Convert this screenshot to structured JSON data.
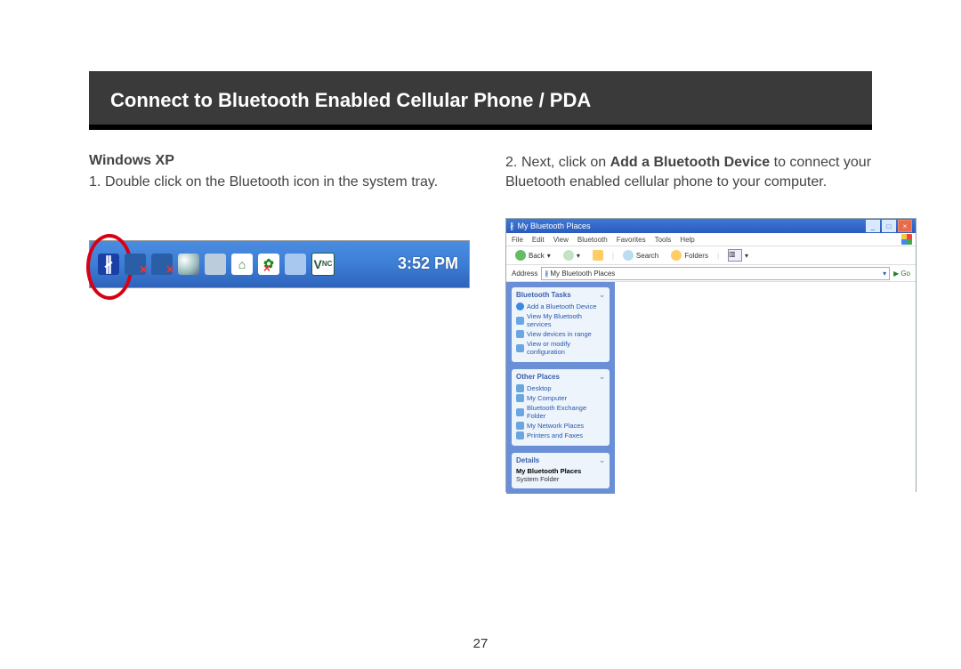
{
  "header": {
    "title": "Connect to Bluetooth Enabled Cellular Phone / PDA"
  },
  "os_label": "Windows XP",
  "steps": {
    "one": {
      "num": "1.",
      "text": "Double click on the Bluetooth icon in the system tray."
    },
    "two": {
      "num": "2.",
      "pre": "Next, click on ",
      "bold": "Add a Bluetooth Device",
      "post": " to connect your Bluetooth enabled cellular phone to your computer."
    }
  },
  "tray": {
    "clock": "3:52 PM"
  },
  "explorer": {
    "title": "My Bluetooth Places",
    "menus": [
      "File",
      "Edit",
      "View",
      "Bluetooth",
      "Favorites",
      "Tools",
      "Help"
    ],
    "toolbar": {
      "back": "Back",
      "search": "Search",
      "folders": "Folders"
    },
    "address": {
      "label": "Address",
      "value": "My Bluetooth Places",
      "go": "Go"
    },
    "panels": {
      "tasks": {
        "header": "Bluetooth Tasks",
        "items": [
          "Add a Bluetooth Device",
          "View My Bluetooth services",
          "View devices in range",
          "View or modify configuration"
        ]
      },
      "other": {
        "header": "Other Places",
        "items": [
          "Desktop",
          "My Computer",
          "Bluetooth Exchange Folder",
          "My Network Places",
          "Printers and Faxes"
        ]
      },
      "details": {
        "header": "Details",
        "name": "My Bluetooth Places",
        "type": "System Folder"
      }
    }
  },
  "page_number": "27"
}
